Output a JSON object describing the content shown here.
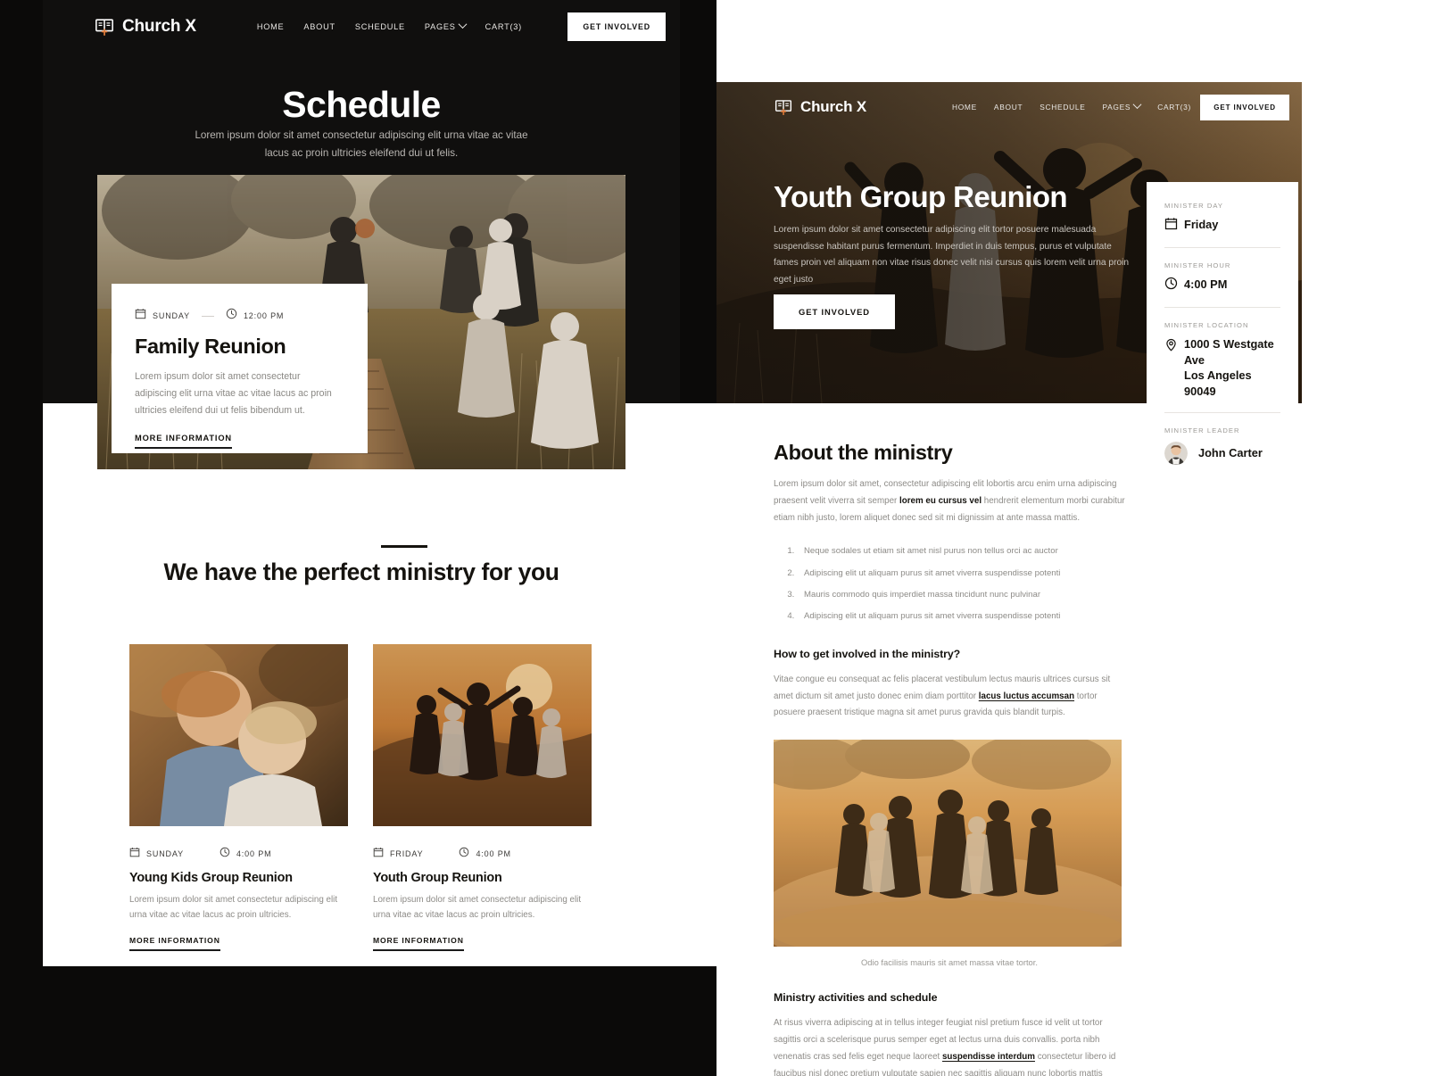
{
  "colors": {
    "dark": "#0b0a09",
    "page_dark": "#100f0e",
    "accent": "#e07b39",
    "text": "#15130f",
    "muted": "#8d8b87"
  },
  "left_page": {
    "nav": {
      "brand": "Church X",
      "logo_icon": "open-book-cross-icon",
      "links": [
        "HOME",
        "ABOUT",
        "SCHEDULE",
        "PAGES",
        "CART(3)"
      ],
      "cta": "GET INVOLVED"
    },
    "hero": {
      "title": "Schedule",
      "subtitle": "Lorem ipsum dolor sit amet consectetur adipiscing elit urna vitae ac vitae lacus ac proin ultricies eleifend dui ut felis.",
      "photo_alt": "family walking on a wooden boardwalk through autumn fields"
    },
    "event_card": {
      "day": "SUNDAY",
      "time": "12:00 PM",
      "title": "Family Reunion",
      "desc": "Lorem ipsum dolor sit amet consectetur adipiscing elit urna vitae ac vitae lacus ac proin ultricies eleifend dui ut felis bibendum ut.",
      "link": "MORE INFORMATION"
    },
    "ministry": {
      "heading": "We have the perfect ministry for you",
      "cards": [
        {
          "day": "SUNDAY",
          "time": "4:00 PM",
          "title": "Young Kids Group Reunion",
          "desc": "Lorem ipsum dolor sit amet consectetur adipiscing elit urna vitae ac vitae lacus ac proin ultricies.",
          "link": "MORE INFORMATION",
          "photo_alt": "two young girls hugging outdoors in autumn"
        },
        {
          "day": "FRIDAY",
          "time": "4:00 PM",
          "title": "Youth Group Reunion",
          "desc": "Lorem ipsum dolor sit amet consectetur adipiscing elit urna vitae ac vitae lacus ac proin ultricies.",
          "link": "MORE INFORMATION",
          "photo_alt": "group of friends with arms raised at sunset on a hill"
        }
      ]
    }
  },
  "right_page": {
    "nav": {
      "brand": "Church X",
      "logo_icon": "open-book-cross-icon",
      "links": [
        "HOME",
        "ABOUT",
        "SCHEDULE",
        "PAGES",
        "CART(3)"
      ],
      "cta": "GET INVOLVED"
    },
    "hero": {
      "title": "Youth Group Reunion",
      "lede": "Lorem ipsum dolor sit amet consectetur adipiscing elit tortor posuere malesuada suspendisse habitant purus fermentum. Imperdiet in duis tempus, purus et vulputate fames proin vel aliquam non vitae risus donec velit nisi cursus quis lorem velit urna proin eget justo",
      "cta": "GET INVOLVED",
      "photo_alt": "friends celebrating together at golden hour"
    },
    "info_card": {
      "blocks": [
        {
          "label": "MINISTER DAY",
          "icon": "calendar-icon",
          "value": "Friday"
        },
        {
          "label": "MINISTER HOUR",
          "icon": "clock-icon",
          "value": "4:00 PM"
        },
        {
          "label": "MINISTER LOCATION",
          "icon": "map-pin-icon",
          "value": "1000 S Westgate Ave\nLos Angeles  90049"
        },
        {
          "label": "MINISTER LEADER",
          "icon": "avatar",
          "value": "John Carter"
        }
      ]
    },
    "article": {
      "heading": "About the ministry",
      "intro_1": "Lorem ipsum dolor sit amet, consectetur adipiscing elit lobortis arcu enim urna adipiscing praesent velit viverra sit semper ",
      "intro_bold": "lorem eu cursus vel",
      "intro_2": " hendrerit elementum morbi curabitur etiam nibh justo, lorem aliquet donec sed sit mi dignissim at ante massa mattis.",
      "list": [
        "Neque sodales ut etiam sit amet nisl purus non tellus orci ac auctor",
        "Adipiscing elit ut aliquam purus sit amet viverra suspendisse potenti",
        "Mauris commodo quis imperdiet massa tincidunt nunc pulvinar",
        "Adipiscing elit ut aliquam purus sit amet viverra suspendisse potenti"
      ],
      "subheading_1": "How to get involved in the ministry?",
      "body_1a": "Vitae congue eu consequat ac felis placerat vestibulum lectus mauris ultrices cursus sit amet dictum sit amet justo donec enim diam porttitor ",
      "body_1_link": "lacus luctus accumsan",
      "body_1b": " tortor posuere praesent tristique magna sit amet purus gravida quis blandit turpis.",
      "figure_caption": "Odio facilisis mauris sit amet massa vitae tortor.",
      "figure_alt": "children running through a dusty field at sunset",
      "subheading_2": "Ministry activities and schedule",
      "body_2a": "At risus viverra adipiscing at in tellus integer feugiat nisl pretium fusce id velit ut tortor sagittis orci a scelerisque purus semper eget at lectus urna duis convallis. porta nibh venenatis cras sed felis eget neque laoreet ",
      "body_2_link": "suspendisse interdum",
      "body_2b": " consectetur libero id faucibus nisl donec pretium vulputate sapien nec sagittis aliquam nunc lobortis mattis"
    }
  }
}
